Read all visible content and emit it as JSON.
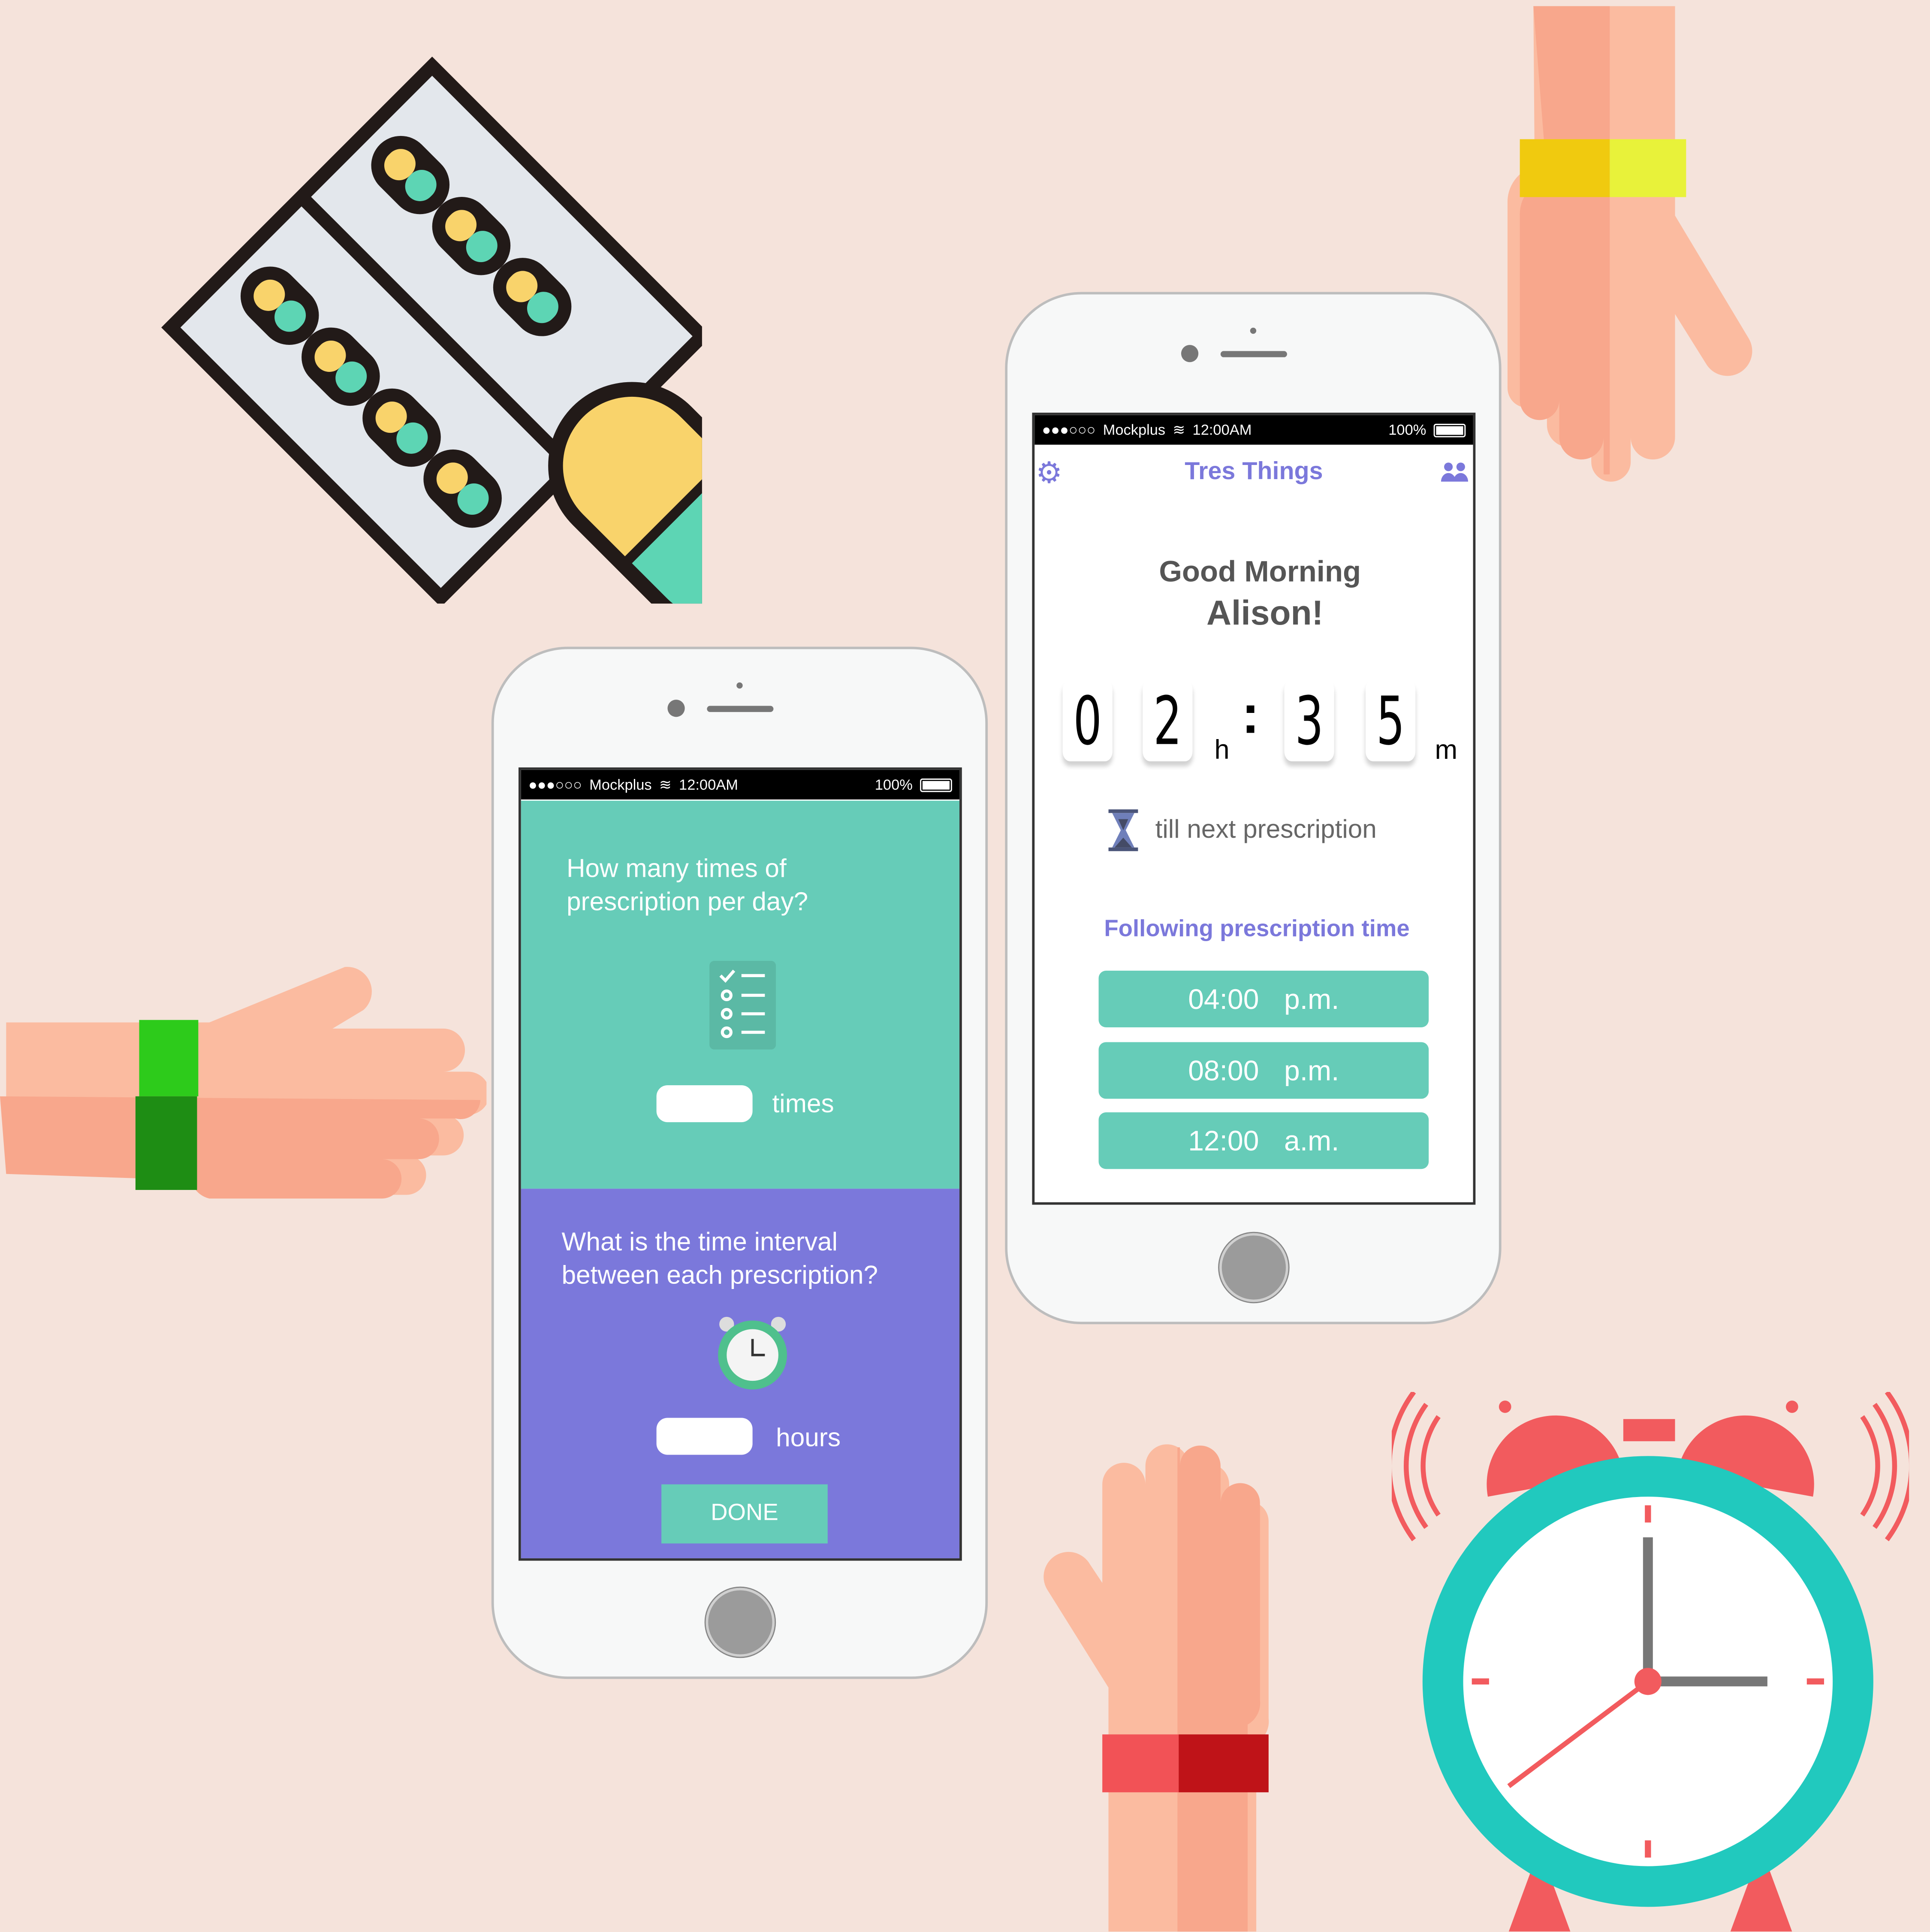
{
  "status_bar": {
    "signal": "●●●○○○",
    "carrier": "Mockplus",
    "time": "12:00AM",
    "battery": "100%"
  },
  "setup_screen": {
    "question1": "How many times of prescription per day?",
    "times_value": "",
    "times_unit": "times",
    "question2": "What is the time interval between each prescription?",
    "hours_value": "",
    "hours_unit": "hours",
    "done_label": "DONE"
  },
  "home_screen": {
    "app_title": "Tres Things",
    "greeting_line1": "Good Morning",
    "greeting_line2": "Alison!",
    "countdown": {
      "h1": "0",
      "h2": "2",
      "h_unit": "h",
      "sep": ":",
      "m1": "3",
      "m2": "5",
      "m_unit": "m"
    },
    "countdown_caption": "till next prescription",
    "following_title": "Following prescription time",
    "times": [
      {
        "time": "04:00",
        "period": "p.m."
      },
      {
        "time": "08:00",
        "period": "p.m."
      },
      {
        "time": "12:00",
        "period": "a.m."
      }
    ]
  },
  "colors": {
    "teal": "#66CCB8",
    "purple": "#7B78DB",
    "background": "#F5E3DB"
  }
}
